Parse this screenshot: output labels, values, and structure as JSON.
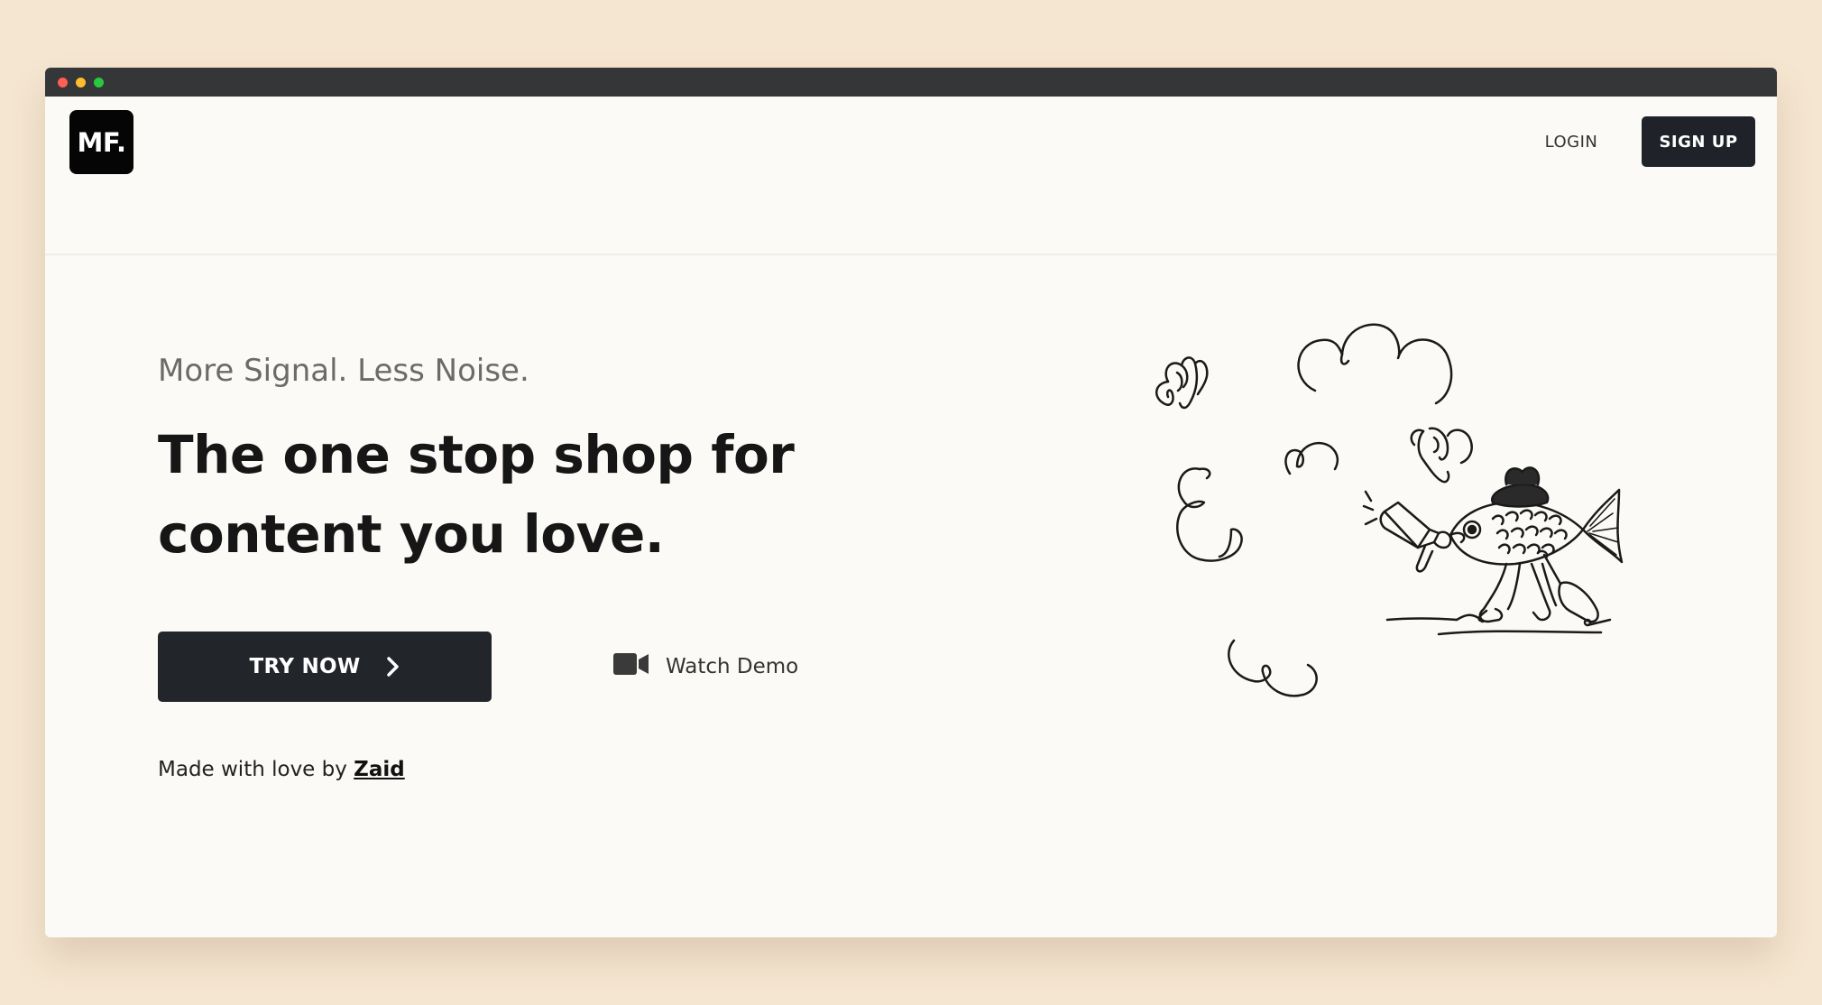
{
  "window": {
    "controls": [
      "close",
      "minimize",
      "maximize"
    ]
  },
  "nav": {
    "logo_text": "MF.",
    "login_label": "LOGIN",
    "signup_label": "SIGN UP"
  },
  "hero": {
    "tagline": "More Signal. Less Noise.",
    "headline": "The one stop shop for content you love.",
    "try_label": "TRY NOW",
    "watch_label": "Watch Demo",
    "credit_prefix": "Made with love by",
    "credit_author": "Zaid"
  },
  "icons": {
    "try_chevron": "chevron-right-icon",
    "watch": "video-camera-icon",
    "illustration": "fish-megaphone-illustration"
  },
  "colors": {
    "page_bg": "#f5e6d1",
    "window_bg": "#fcfaf6",
    "titlebar": "#353638",
    "button_dark": "#1f2329",
    "tagline": "#6b6b6b"
  }
}
